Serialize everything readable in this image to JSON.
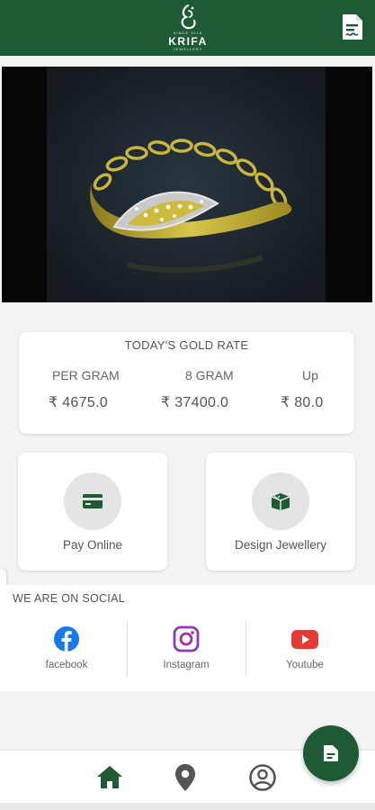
{
  "app": {
    "logo_brand": "KRIFA",
    "logo_top": "SINCE 2016",
    "logo_sub": "JEWELLERY",
    "header_action_icon": "document-icon"
  },
  "hero": {
    "image_subject": "gold-and-diamond-leaf-bracelet"
  },
  "gold_rate": {
    "title": "TODAY'S GOLD RATE",
    "columns": [
      {
        "label": "PER GRAM",
        "value": "₹ 4675.0"
      },
      {
        "label": "8 GRAM",
        "value": "₹ 37400.0"
      },
      {
        "label": "Up",
        "value": "₹ 80.0"
      }
    ]
  },
  "tiles": [
    {
      "label": "Pay Online",
      "icon": "card-icon"
    },
    {
      "label": "Design Jewellery",
      "icon": "box-icon"
    }
  ],
  "social": {
    "title": "WE ARE ON SOCIAL",
    "items": [
      {
        "label": "facebook",
        "icon": "facebook-icon",
        "color": "#1877f2"
      },
      {
        "label": "Instagram",
        "icon": "instagram-icon",
        "color": "#8a3ab9"
      },
      {
        "label": "Youtube",
        "icon": "youtube-icon",
        "color": "#e53935"
      }
    ]
  },
  "bottom_nav": [
    {
      "icon": "home-icon"
    },
    {
      "icon": "location-icon"
    },
    {
      "icon": "account-icon"
    }
  ],
  "fab": {
    "icon": "document-icon"
  },
  "colors": {
    "primary": "#1e5b34",
    "background": "#f3f3f3",
    "card": "#ffffff"
  }
}
